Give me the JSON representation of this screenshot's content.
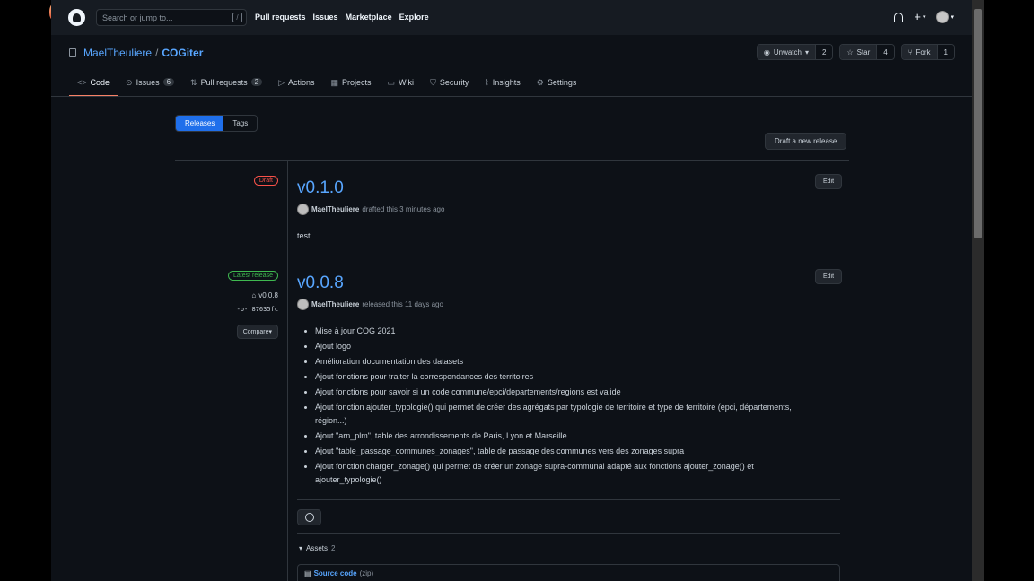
{
  "header": {
    "search_placeholder": "Search or jump to...",
    "search_shortcut": "/",
    "nav": [
      "Pull requests",
      "Issues",
      "Marketplace",
      "Explore"
    ]
  },
  "repo": {
    "owner": "MaelTheuliere",
    "separator": "/",
    "name": "COGiter",
    "actions": {
      "watch_label": "Unwatch",
      "watch_count": "2",
      "star_label": "Star",
      "star_count": "4",
      "fork_label": "Fork",
      "fork_count": "1"
    },
    "tabs": [
      {
        "label": "Code",
        "icon": "code-icon",
        "badge": ""
      },
      {
        "label": "Issues",
        "icon": "issue-icon",
        "badge": "6"
      },
      {
        "label": "Pull requests",
        "icon": "pull-request-icon",
        "badge": "2"
      },
      {
        "label": "Actions",
        "icon": "play-icon",
        "badge": ""
      },
      {
        "label": "Projects",
        "icon": "project-icon",
        "badge": ""
      },
      {
        "label": "Wiki",
        "icon": "book-icon",
        "badge": ""
      },
      {
        "label": "Security",
        "icon": "shield-icon",
        "badge": ""
      },
      {
        "label": "Insights",
        "icon": "graph-icon",
        "badge": ""
      },
      {
        "label": "Settings",
        "icon": "gear-icon",
        "badge": ""
      }
    ]
  },
  "releases_page": {
    "subnav": [
      "Releases",
      "Tags"
    ],
    "draft_button": "Draft a new release",
    "edit_label": "Edit",
    "releases": [
      {
        "label": "Draft",
        "title": "v0.1.0",
        "author": "MaelTheuliere",
        "meta": "drafted this 3 minutes ago",
        "body": "test"
      },
      {
        "label": "Latest release",
        "tag": "v0.0.8",
        "commit": "87635fc",
        "compare_label": "Compare",
        "title": "v0.0.8",
        "author": "MaelTheuliere",
        "meta": "released this 11 days ago",
        "notes": [
          "Mise à jour COG 2021",
          "Ajout logo",
          "Amélioration documentation des datasets",
          "Ajout fonctions pour traiter la correspondances des territoires",
          "Ajout fonctions pour savoir si un code commune/epci/departements/regions est valide",
          "Ajout fonction ajouter_typologie() qui permet de créer des agrégats par typologie de territoire et type de territoire (epci, départements, région...)",
          "Ajout \"arn_plm\", table des arrondissements de Paris, Lyon et Marseille",
          "Ajout \"table_passage_communes_zonages\", table de passage des communes vers des zonages supra",
          "Ajout fonction charger_zonage() qui permet de créer un zonage supra-communal adapté aux fonctions ajouter_zonage() et ajouter_typologie()"
        ],
        "assets_label": "Assets",
        "assets_count": "2",
        "asset_name": "Source code",
        "asset_sub": "(zip)"
      }
    ]
  },
  "colors": {
    "background": "#0d1117",
    "header": "#161b22",
    "link": "#58a6ff",
    "accent": "#1f6feb",
    "draft": "#f85149",
    "latest": "#3fb950"
  }
}
